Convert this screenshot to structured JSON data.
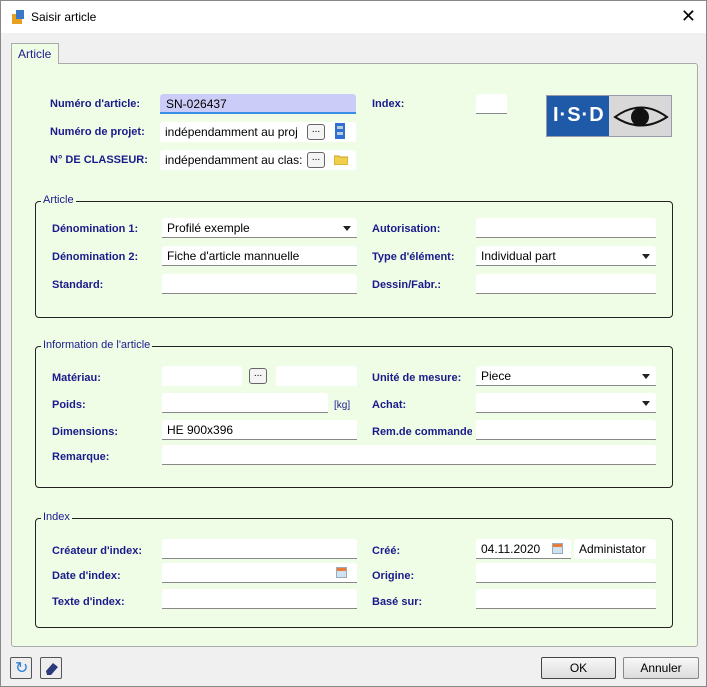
{
  "window": {
    "title": "Saisir article"
  },
  "tab": {
    "label": "Article"
  },
  "header": {
    "article_number_label": "Numéro d'article:",
    "article_number": "SN-026437",
    "project_label": "Numéro de projet:",
    "project_value": "indépendamment au proj",
    "binder_label": "N° DE CLASSEUR:",
    "binder_value": "indépendamment au clas:",
    "index_label": "Index:",
    "index_value": "",
    "browse": "...",
    "logo_text": "I·S·D"
  },
  "article": {
    "title": "Article",
    "den1_label": "Dénomination 1:",
    "den1": "Profilé exemple",
    "den2_label": "Dénomination  2:",
    "den2": "Fiche d'article mannuelle",
    "standard_label": "Standard:",
    "standard": "",
    "auth_label": "Autorisation:",
    "auth": "",
    "type_label": "Type d'élément:",
    "type": "Individual part",
    "drawing_label": "Dessin/Fabr.:",
    "drawing": ""
  },
  "info": {
    "title": "Information de l'article",
    "material_label": "Matériau:",
    "weight_label": "Poids:",
    "weight_unit": "[kg]",
    "dimensions_label": "Dimensions:",
    "dimensions": "HE 900x396",
    "remark_label": "Remarque:",
    "unit_label": "Unité de mesure:",
    "unit": "Piece",
    "purchase_label": "Achat:",
    "order_label": "Rem.de commande"
  },
  "index": {
    "title": "Index",
    "creator_label": "Créateur d'index:",
    "date_label": "Date d'index:",
    "text_label": "Texte d'index:",
    "created_label": "Créé:",
    "created_date": "04.11.2020",
    "created_by": "Administator",
    "origin_label": "Origine:",
    "based_label": "Basé sur:"
  },
  "footer": {
    "ok": "OK",
    "cancel": "Annuler"
  }
}
